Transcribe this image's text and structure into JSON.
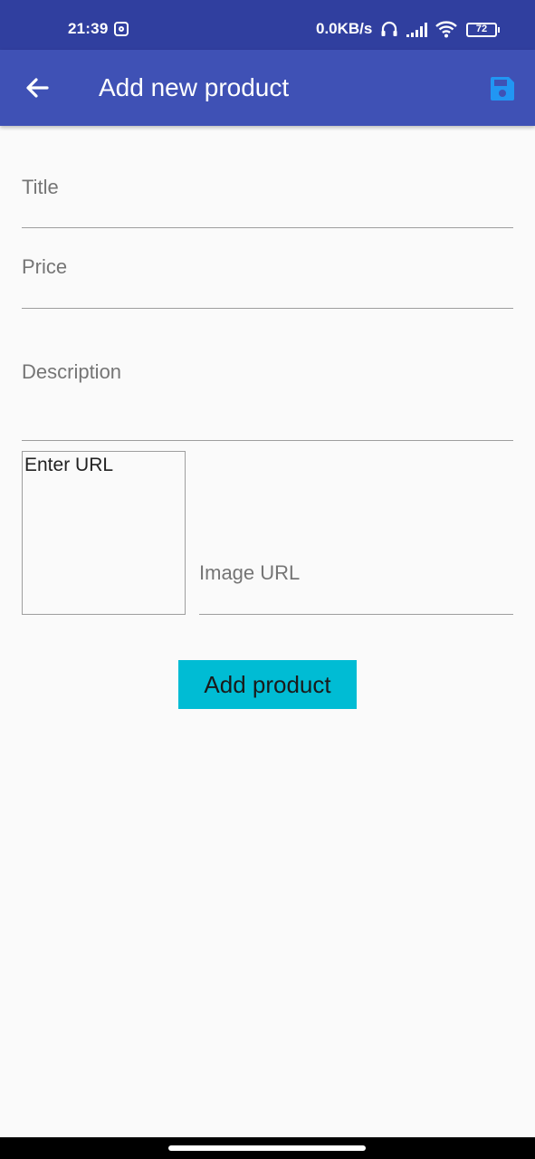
{
  "status_bar": {
    "time": "21:39",
    "network_speed": "0.0KB/s",
    "battery_level": "72",
    "icons": [
      "instagram-icon",
      "headset-icon",
      "signal-icon",
      "wifi-icon",
      "battery-icon"
    ]
  },
  "app_bar": {
    "title": "Add new product",
    "back_icon": "arrow-left-icon",
    "save_icon": "save-icon",
    "background_color": "#3f51b5",
    "status_color": "#303f9f",
    "accent_color": "#2196f3"
  },
  "form": {
    "title_placeholder": "Title",
    "title_value": "",
    "price_placeholder": "Price",
    "price_value": "",
    "description_placeholder": "Description",
    "description_value": "",
    "image_preview_text": "Enter URL",
    "image_url_placeholder": "Image URL",
    "image_url_value": "",
    "submit_label": "Add product",
    "submit_color": "#00bcd4"
  }
}
